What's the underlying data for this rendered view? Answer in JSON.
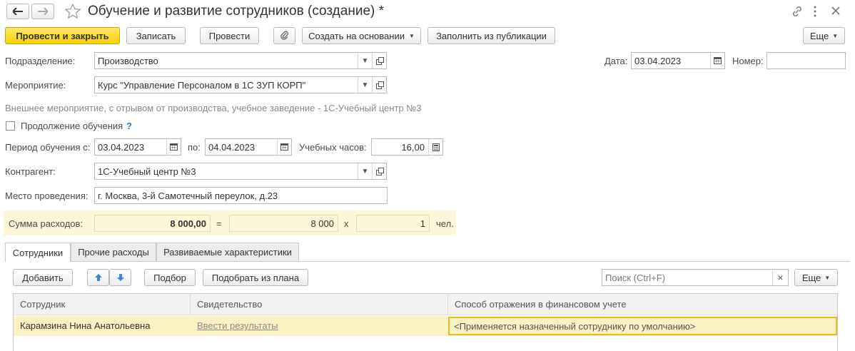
{
  "window": {
    "title": "Обучение и развитие сотрудников (создание) *"
  },
  "toolbar": {
    "post_close": "Провести и закрыть",
    "save": "Записать",
    "post": "Провести",
    "create_based": "Создать на основании",
    "fill_from_pub": "Заполнить из публикации",
    "more": "Еще"
  },
  "form": {
    "subdivision_label": "Подразделение:",
    "subdivision_value": "Производство",
    "date_label": "Дата:",
    "date_value": "03.04.2023",
    "number_label": "Номер:",
    "number_value": "",
    "event_label": "Мероприятие:",
    "event_value": "Курс \"Управление Персоналом в 1С ЗУП КОРП\"",
    "event_info": "Внешнее мероприятие, с отрывом от производства, учебное заведение - 1С-Учебный центр №3",
    "continuation_label": "Продолжение обучения",
    "help_mark": "?",
    "period_label": "Период обучения с:",
    "period_from": "03.04.2023",
    "period_to_label": "по:",
    "period_to": "04.04.2023",
    "hours_label": "Учебных часов:",
    "hours_value": "16,00",
    "counterparty_label": "Контрагент:",
    "counterparty_value": "1С-Учебный центр №3",
    "place_label": "Место проведения:",
    "place_value": "г. Москва, 3-й Самотечный переулок, д.23",
    "expenses_label": "Сумма расходов:",
    "expenses_total": "8 000,00",
    "eq_sign": "=",
    "expenses_per": "8 000",
    "times_sign": "x",
    "people_count": "1",
    "people_unit": "чел."
  },
  "tabs": [
    {
      "label": "Сотрудники"
    },
    {
      "label": "Прочие расходы"
    },
    {
      "label": "Развиваемые характеристики"
    }
  ],
  "table_toolbar": {
    "add": "Добавить",
    "pick": "Подбор",
    "pick_plan": "Подобрать из плана",
    "search_placeholder": "Поиск (Ctrl+F)",
    "clear": "×",
    "more": "Еще"
  },
  "table": {
    "columns": [
      "Сотрудник",
      "Свидетельство",
      "Способ отражения в финансовом учете"
    ],
    "rows": [
      {
        "employee": "Карамзина Нина Анатольевна",
        "certificate": "Ввести результаты",
        "reflection": "<Применяется назначенный сотруднику по умолчанию>"
      }
    ]
  },
  "colors": {
    "accent": "#f9d300",
    "selected_row": "#fbf1c3",
    "highlight": "#fdf6d8"
  }
}
